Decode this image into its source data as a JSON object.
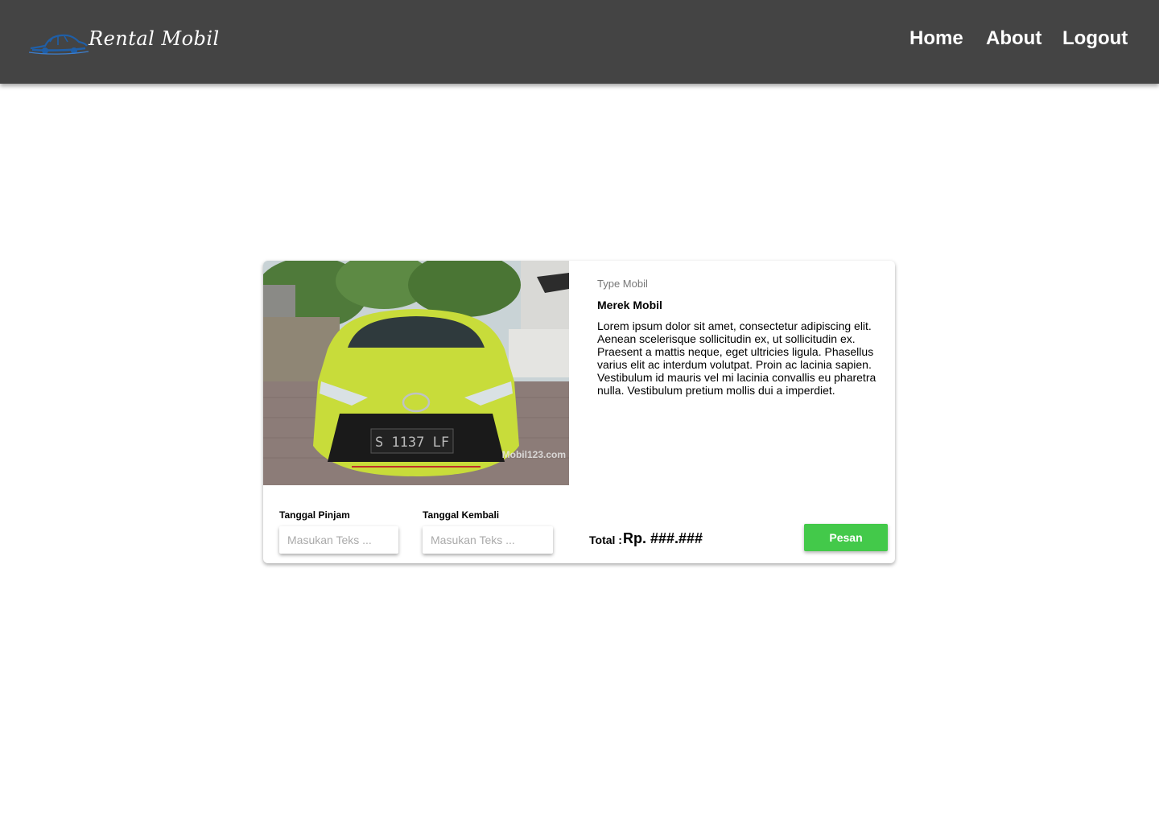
{
  "navbar": {
    "logo_text": "Rental Mobil",
    "links": [
      {
        "label": "Home"
      },
      {
        "label": "About"
      },
      {
        "label": "Logout"
      }
    ]
  },
  "product": {
    "type_label": "Type Mobil",
    "brand_label": "Merek Mobil",
    "description": "Lorem ipsum dolor sit amet, consectetur adipiscing elit. Aenean scelerisque sollicitudin ex, ut sollicitudin ex. Praesent a mattis neque, eget ultricies ligula. Phasellus varius elit ac interdum volutpat. Proin ac lacinia sapien. Vestibulum id mauris vel mi lacinia convallis eu pharetra nulla. Vestibulum pretium mollis dui a imperdiet.",
    "photo": {
      "plate_text": "S 1137 LF",
      "watermark": "Mobil123.com"
    }
  },
  "booking": {
    "start_date": {
      "label": "Tanggal Pinjam",
      "placeholder": "Masukan Teks ...",
      "value": ""
    },
    "end_date": {
      "label": "Tanggal Kembali",
      "placeholder": "Masukan Teks ...",
      "value": ""
    },
    "total_label": "Total :",
    "total_value": "Rp. ###.###",
    "submit_label": "Pesan"
  },
  "colors": {
    "navbar_bg": "#444444",
    "button_green": "#43c94a",
    "logo_blue": "#1f5fa8",
    "car_yellow": "#c8dc3a"
  },
  "icons": {
    "logo": "car-logo-icon"
  }
}
